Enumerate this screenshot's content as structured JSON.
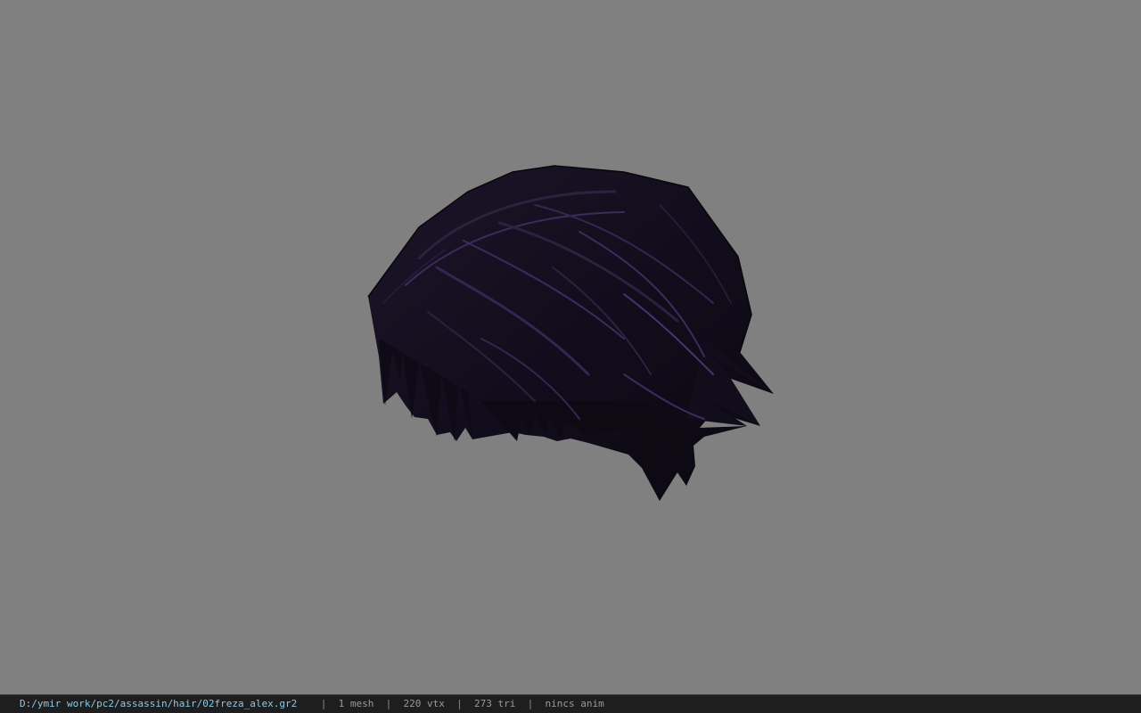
{
  "viewport": {
    "background_color": "#808080",
    "model": {
      "icon": "hair-mesh-model",
      "colors": [
        "#0b0912",
        "#1a1427",
        "#2c2240",
        "#3d2b5c"
      ]
    }
  },
  "status_bar": {
    "file_path": "D:/ymir work/pc2/assassin/hair/02freza_alex.gr2",
    "separator": "|",
    "mesh_count": "1 mesh",
    "vertex_count": "220 vtx",
    "triangle_count": "273 tri",
    "anim_status": "nincs anim"
  }
}
